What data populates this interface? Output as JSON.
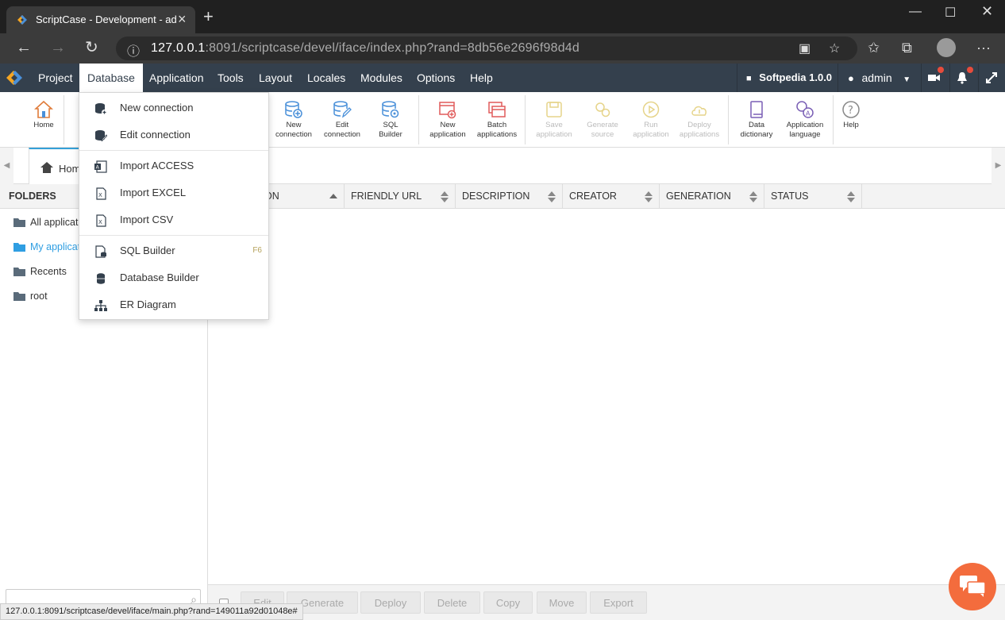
{
  "browser": {
    "tab_title": "ScriptCase - Development - admin",
    "url_host": "127.0.0.1",
    "url_rest": ":8091/scriptcase/devel/iface/index.php?rand=8db56e2696f98d4d"
  },
  "menubar": {
    "items": [
      "Project",
      "Database",
      "Application",
      "Tools",
      "Layout",
      "Locales",
      "Modules",
      "Options",
      "Help"
    ],
    "active": "Database",
    "project_name": "Softpedia 1.0.0",
    "user": "admin"
  },
  "toolbar": {
    "home": "Home",
    "new_connection": [
      "New",
      "connection"
    ],
    "edit_connection": [
      "Edit",
      "connection"
    ],
    "sql_builder": [
      "SQL",
      "Builder"
    ],
    "new_application": [
      "New",
      "application"
    ],
    "batch_applications": [
      "Batch",
      "applications"
    ],
    "save_application": [
      "Save",
      "application"
    ],
    "generate_source": [
      "Generate",
      "source"
    ],
    "run_application": [
      "Run",
      "application"
    ],
    "deploy_applications": [
      "Deploy",
      "applications"
    ],
    "data_dictionary": [
      "Data",
      "dictionary"
    ],
    "application_language": [
      "Application",
      "language"
    ],
    "help": "Help"
  },
  "tabs": {
    "home": "Home"
  },
  "sidebar": {
    "title": "FOLDERS",
    "folders": [
      "All applications",
      "My applications",
      "Recents",
      "root"
    ],
    "active_index": 1
  },
  "grid": {
    "columns": [
      "APPLICATION",
      "FRIENDLY URL",
      "DESCRIPTION",
      "CREATOR",
      "GENERATION",
      "STATUS"
    ]
  },
  "actions": [
    "Edit",
    "Generate",
    "Deploy",
    "Delete",
    "Copy",
    "Move",
    "Export"
  ],
  "status_url": "127.0.0.1:8091/scriptcase/devel/iface/main.php?rand=149011a92d01048e#",
  "dropdown": {
    "items": [
      {
        "label": "New connection"
      },
      {
        "label": "Edit connection"
      },
      {
        "label": "Import ACCESS"
      },
      {
        "label": "Import EXCEL"
      },
      {
        "label": "Import CSV"
      },
      {
        "label": "SQL Builder",
        "shortcut": "F6"
      },
      {
        "label": "Database Builder"
      },
      {
        "label": "ER Diagram"
      }
    ]
  },
  "colors": {
    "menubar": "#34404d",
    "accent": "#34a0d8",
    "folder_active": "#2f9ee2",
    "chat": "#f36c3d"
  }
}
